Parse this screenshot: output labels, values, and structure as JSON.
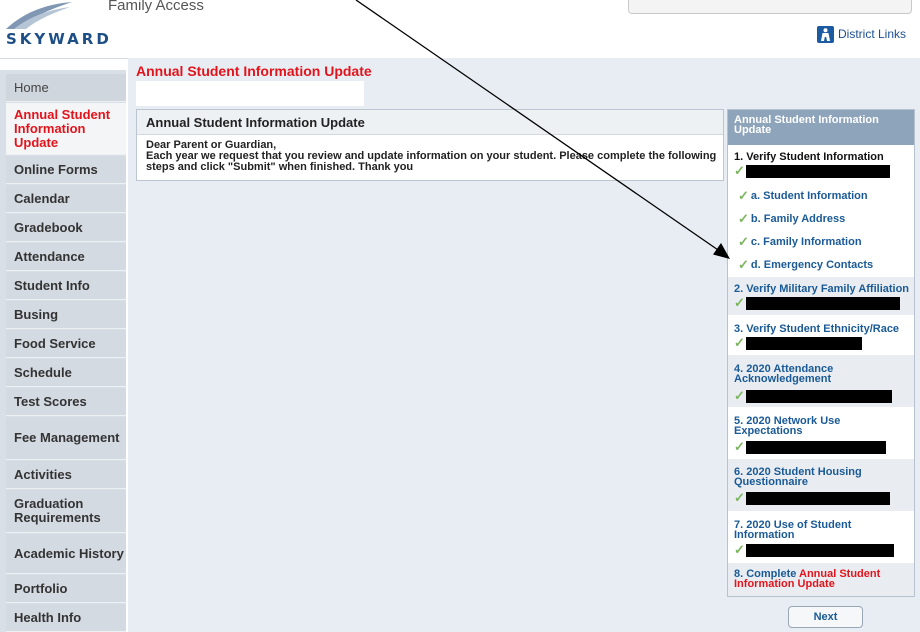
{
  "header": {
    "logo_text": "SKYWARD",
    "app_name": "Family Access",
    "district_links": "District Links"
  },
  "sidebar": {
    "items": [
      {
        "label": "Home"
      },
      {
        "label": "Annual Student Information Update"
      },
      {
        "label": "Online Forms"
      },
      {
        "label": "Calendar"
      },
      {
        "label": "Gradebook"
      },
      {
        "label": "Attendance"
      },
      {
        "label": "Student Info"
      },
      {
        "label": "Busing"
      },
      {
        "label": "Food Service"
      },
      {
        "label": "Schedule"
      },
      {
        "label": "Test Scores"
      },
      {
        "label": "Fee Management"
      },
      {
        "label": "Activities"
      },
      {
        "label": "Graduation Requirements"
      },
      {
        "label": "Academic History"
      },
      {
        "label": "Portfolio"
      },
      {
        "label": "Health Info"
      }
    ]
  },
  "main": {
    "page_title": "Annual Student Information Update",
    "box_title": "Annual Student Information Update",
    "greeting": "Dear Parent or Guardian,",
    "body": "Each year we request that you review and update information on your student. Please complete the following steps and click \"Submit\" when finished. Thank you"
  },
  "panel": {
    "title": "Annual Student Information Update",
    "steps": [
      {
        "label": "1. Verify Student Information"
      },
      {
        "label": "2. Verify Military Family Affiliation"
      },
      {
        "label": "3. Verify Student Ethnicity/Race"
      },
      {
        "label": "4. 2020 Attendance Acknowledgement"
      },
      {
        "label": "5. 2020 Network Use Expectations"
      },
      {
        "label": "6. 2020 Student Housing Questionnaire"
      },
      {
        "label": "7. 2020 Use of Student Information"
      },
      {
        "label_prefix": "8. Complete ",
        "label_suffix": "Annual Student Information Update"
      }
    ],
    "substeps": [
      {
        "label": "a. Student Information"
      },
      {
        "label": "b. Family Address"
      },
      {
        "label": "c. Family Information"
      },
      {
        "label": "d. Emergency Contacts"
      }
    ],
    "check_icon": "checkmark-icon"
  },
  "next_button": "Next",
  "colors": {
    "accent_red": "#e2141b",
    "link_blue": "#1a5a96",
    "panel_header": "#8ea4bb",
    "sidebar": "#d4dae2",
    "check_green": "#7bb55f"
  }
}
